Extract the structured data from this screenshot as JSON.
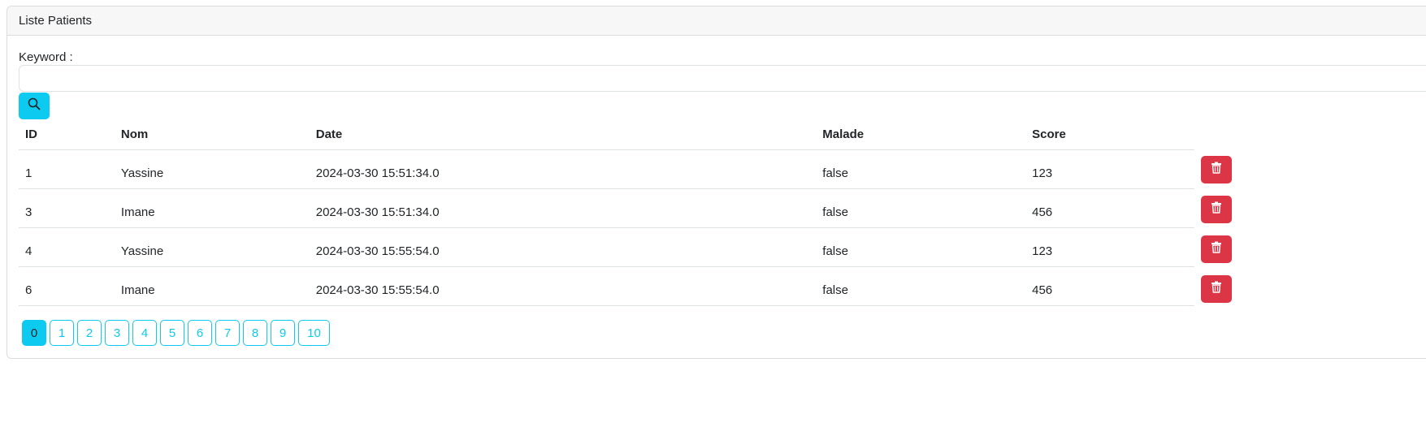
{
  "card": {
    "title": "Liste Patients"
  },
  "search": {
    "label": "Keyword :",
    "value": "",
    "placeholder": "",
    "button_icon": "search-icon",
    "button_color": "#0dcaf0"
  },
  "table": {
    "headers": [
      "ID",
      "Nom",
      "Date",
      "Malade",
      "Score"
    ],
    "rows": [
      {
        "id": "1",
        "nom": "Yassine",
        "date": "2024-03-30 15:51:34.0",
        "malade": "false",
        "score": "123"
      },
      {
        "id": "3",
        "nom": "Imane",
        "date": "2024-03-30 15:51:34.0",
        "malade": "false",
        "score": "456"
      },
      {
        "id": "4",
        "nom": "Yassine",
        "date": "2024-03-30 15:55:54.0",
        "malade": "false",
        "score": "123"
      },
      {
        "id": "6",
        "nom": "Imane",
        "date": "2024-03-30 15:55:54.0",
        "malade": "false",
        "score": "456"
      }
    ],
    "delete_icon": "trash-icon",
    "delete_color": "#dc3545"
  },
  "pagination": {
    "pages": [
      "0",
      "1",
      "2",
      "3",
      "4",
      "5",
      "6",
      "7",
      "8",
      "9",
      "10"
    ],
    "active": "0"
  }
}
